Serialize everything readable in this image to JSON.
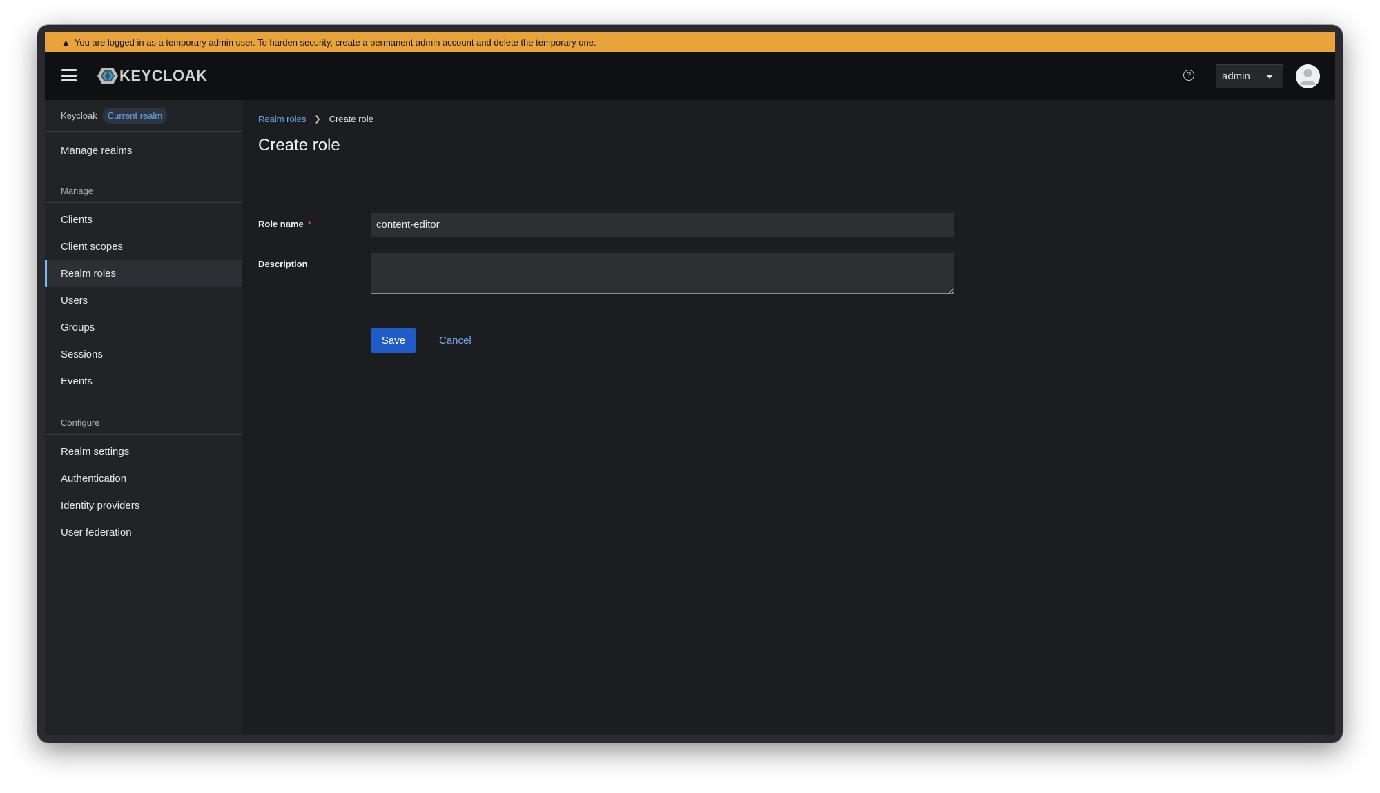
{
  "banner": {
    "icon": "warning-triangle-icon",
    "text": "You are logged in as a temporary admin user. To harden security, create a permanent admin account and delete the temporary one."
  },
  "masthead": {
    "logo_text": "KEYCLOAK",
    "user_label": "admin"
  },
  "sidebar": {
    "realm_name": "Keycloak",
    "realm_badge": "Current realm",
    "manage_realms": "Manage realms",
    "manage_title": "Manage",
    "manage_items": [
      "Clients",
      "Client scopes",
      "Realm roles",
      "Users",
      "Groups",
      "Sessions",
      "Events"
    ],
    "configure_title": "Configure",
    "configure_items": [
      "Realm settings",
      "Authentication",
      "Identity providers",
      "User federation"
    ]
  },
  "breadcrumb": {
    "parent": "Realm roles",
    "current": "Create role"
  },
  "page": {
    "title": "Create role"
  },
  "form": {
    "role_name_label": "Role name",
    "required_marker": "*",
    "role_name_value": "content-editor",
    "description_label": "Description",
    "description_value": "",
    "save_label": "Save",
    "cancel_label": "Cancel"
  },
  "colors": {
    "banner": "#e8a33a",
    "primary_button": "#1f5cc8",
    "link": "#73a9f0",
    "active_indicator": "#73bcf7"
  }
}
